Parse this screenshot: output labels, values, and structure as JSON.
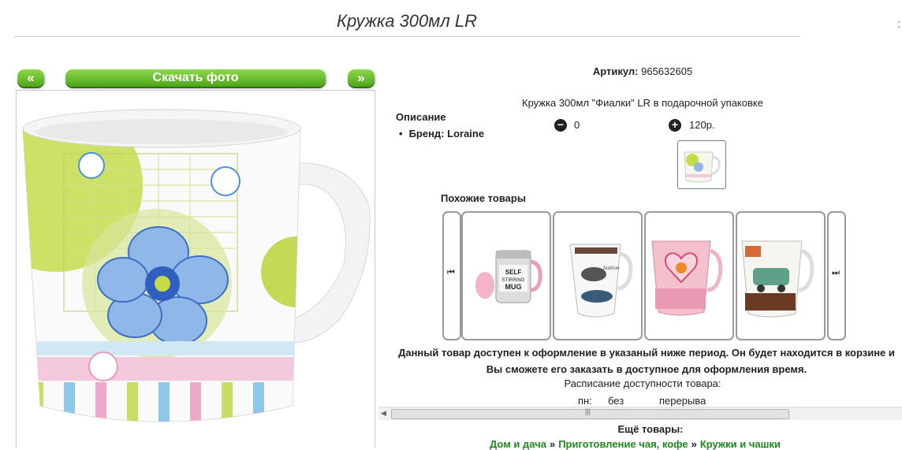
{
  "page": {
    "title": "Кружка 300мл LR",
    "edge_mark": ":"
  },
  "photo_nav": {
    "prev_label": "«",
    "download_label": "Скачать фото",
    "next_label": "»"
  },
  "product": {
    "sku_label": "Артикул:",
    "sku_value": "965632605",
    "description_text": "Кружка 300мл \"Фиалки\" LR в подарочной упаковке",
    "description_heading": "Описание",
    "brand_text": "Бренд: Loraine",
    "quantity": "0",
    "price": "120р."
  },
  "similar": {
    "heading": "Похожие товары",
    "items": [
      {
        "name": "self-stirring-mug"
      },
      {
        "name": "fashion-mug"
      },
      {
        "name": "heart-mug"
      },
      {
        "name": "car-mug"
      }
    ]
  },
  "availability": {
    "notice": "Данный товар доступен к оформление в указаный ниже период. Он будет находится в корзине и Вы сможете его заказать в доступное для оформления время.",
    "schedule_heading": "Расписание доступности товара:",
    "day": "пн:",
    "col2": "без",
    "col3": "перерыва"
  },
  "more": {
    "heading": "Ещё товары:",
    "breadcrumbs": [
      "Дом и дача",
      "Приготовление чая, кофе",
      "Кружки и чашки"
    ],
    "separator": "»"
  },
  "colors": {
    "button_green": "#5cb82a",
    "link_green": "#1e8a1e"
  }
}
